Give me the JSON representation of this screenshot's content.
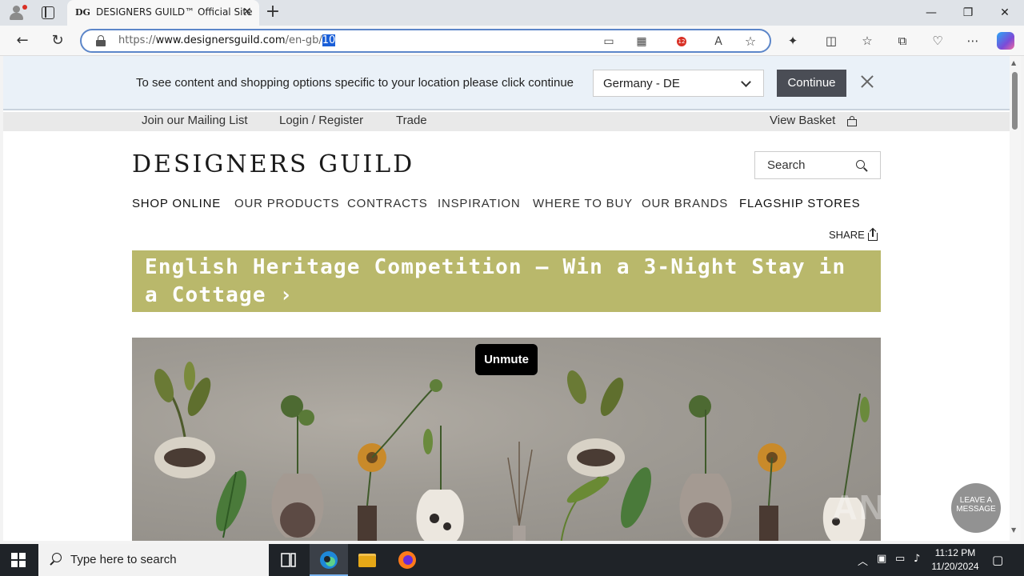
{
  "browser": {
    "tab": {
      "favicon_text": "DG",
      "title": "DESIGNERS GUILD™ Official Site"
    },
    "address": {
      "scheme": "https://",
      "host": "www.designersguild.com",
      "path": "/en-gb/",
      "selected": "10"
    },
    "badge_count": "12"
  },
  "geo_banner": {
    "message": "To see content and shopping options specific to your location please click continue",
    "selected_country": "Germany - DE",
    "continue_label": "Continue"
  },
  "utility_links": {
    "mailing": "Join our Mailing List",
    "login": "Login / Register",
    "trade": "Trade",
    "basket": "View Basket"
  },
  "header": {
    "logo": "DESIGNERS GUILD",
    "search_placeholder": "Search"
  },
  "main_nav": [
    "SHOP ONLINE",
    "OUR PRODUCTS",
    "CONTRACTS",
    "INSPIRATION",
    "WHERE TO BUY",
    "OUR BRANDS",
    "FLAGSHIP STORES"
  ],
  "share_label": "SHARE",
  "promo": {
    "text": "English Heritage Competition – Win a 3-Night Stay in a Cottage ›"
  },
  "video": {
    "unmute_label": "Unmute"
  },
  "chat": {
    "label": "LEAVE A MESSAGE"
  },
  "watermark": "ANY.RUN",
  "taskbar": {
    "search_placeholder": "Type here to search",
    "time": "11:12 PM",
    "date": "11/20/2024"
  },
  "colors": {
    "promo_bg": "#b9b86b",
    "geo_banner_bg": "#eaf1f8",
    "continue_bg": "#4a4d55",
    "omnibox_focus": "#5c86c9"
  }
}
